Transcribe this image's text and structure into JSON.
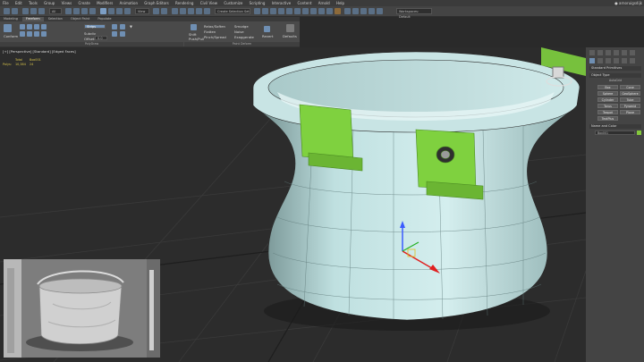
{
  "menu": {
    "items": [
      "File",
      "Edit",
      "Tools",
      "Group",
      "Views",
      "Create",
      "Modifiers",
      "Animation",
      "Graph Editors",
      "Rendering",
      "Civil View",
      "Customize",
      "Scripting",
      "Interactive",
      "Content",
      "Arnold",
      "Help"
    ],
    "user": "arnoruigsdijk"
  },
  "toolbar": {
    "filter_value": "All",
    "view_value": "View",
    "selection_set_placeholder": "Create Selection Set",
    "workspace_value": "Workspaces: Default"
  },
  "ribbon": {
    "tabs": [
      "Modeling",
      "Freeform",
      "Selection",
      "Object Paint",
      "Populate"
    ],
    "active_tab": "Freeform",
    "polydraw": {
      "conform": "Conform",
      "offset_label": "Offset:",
      "offset_value": "0.0",
      "subdiv": "Subdiv",
      "extrude_label": "Strips",
      "group_label": "PolyDraw"
    },
    "paint_deform": {
      "shift": "Shift",
      "push_pull": "Push/Pull",
      "relax_soften": "Relax/Soften",
      "smudge": "Smudge",
      "flatten": "Flatten",
      "noise": "Noise",
      "pinch_spread": "Pinch/Spread",
      "exaggerate": "Exaggerate",
      "revert": "Revert",
      "defaults": "Defaults",
      "group_label": "Paint Deform"
    }
  },
  "viewport": {
    "label": "[+] [Perspective] [Standard] [Edged Faces]",
    "stats": {
      "header_total": "Total",
      "header_selected": "Box001",
      "polys_label": "Polys:",
      "polys_total": "10,384",
      "polys_selected": "24"
    }
  },
  "command_panel": {
    "category": "Standard Primitives",
    "object_type_header": "Object Type",
    "autogrid": "AutoGrid",
    "buttons": [
      "Box",
      "Cone",
      "Sphere",
      "GeoSphere",
      "Cylinder",
      "Tube",
      "Torus",
      "Pyramid",
      "Teapot",
      "Plane",
      "TextPlus"
    ],
    "name_color_header": "Name and Color",
    "name_value": "Box001",
    "name_color": "#84c83c"
  },
  "colors": {
    "pot_body": "#b9dcdc",
    "handles": "#7fd13f",
    "background": "#2c2c2c"
  }
}
